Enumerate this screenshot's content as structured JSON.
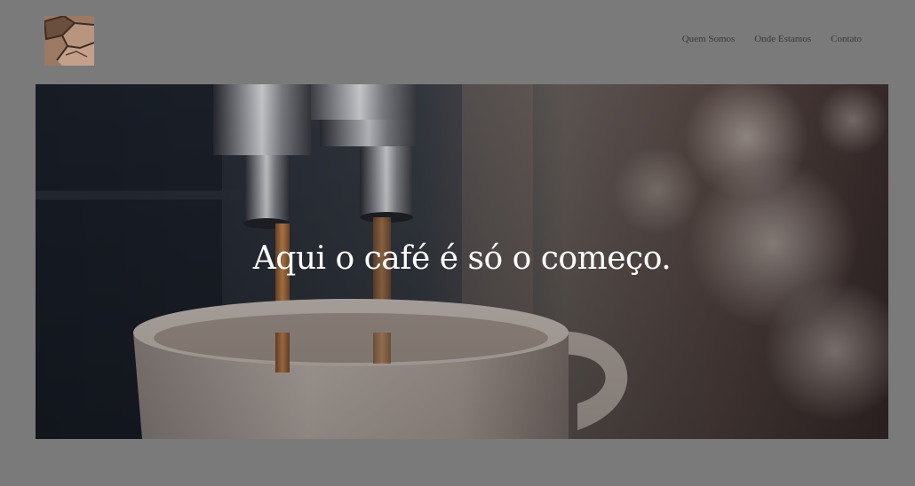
{
  "header": {
    "logo_icon": "coffee-beans-logo-icon",
    "nav": [
      {
        "label": "Quem Somos"
      },
      {
        "label": "Onde Estamos"
      },
      {
        "label": "Contato"
      }
    ]
  },
  "hero": {
    "title": "Aqui o café é só o começo.",
    "image_icon": "espresso-machine-pouring-coffee-image"
  },
  "colors": {
    "page_background": "#7b7a7b",
    "nav_text": "#3a3a3a",
    "hero_title": "#ffffff",
    "coffee_stream": "#c4804a"
  }
}
